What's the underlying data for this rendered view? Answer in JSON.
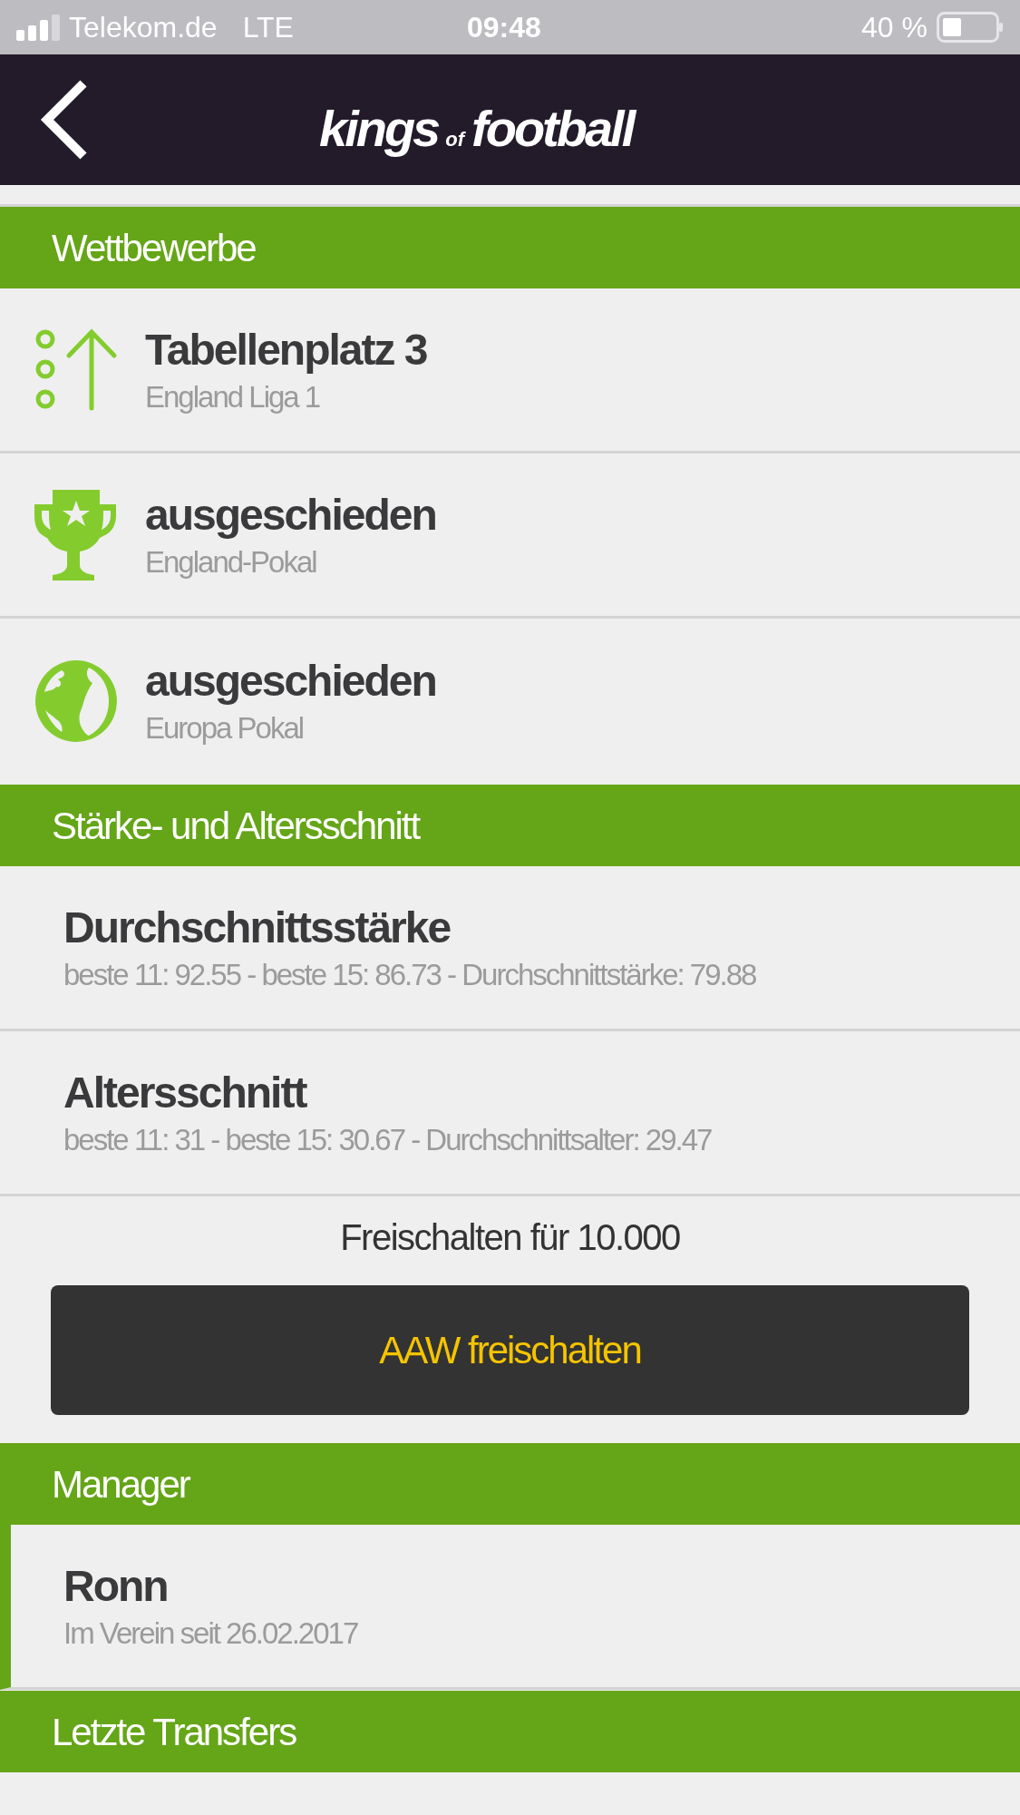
{
  "status_bar": {
    "carrier": "Telekom.de",
    "network": "LTE",
    "time": "09:48",
    "battery": "40 %"
  },
  "header": {
    "logo": [
      "kings",
      "of",
      "football"
    ]
  },
  "sections": [
    {
      "title": "Wettbewerbe",
      "kind": "competitions",
      "items": [
        {
          "kind": "table",
          "title": "Tabellenplatz 3",
          "subtitle": "England Liga 1"
        },
        {
          "kind": "cup",
          "title": "ausgeschieden",
          "subtitle": "England-Pokal"
        },
        {
          "kind": "globe",
          "title": "ausgeschieden",
          "subtitle": "Europa Pokal"
        }
      ]
    },
    {
      "title": "Stärke- und Altersschnitt",
      "kind": "stats",
      "items": [
        {
          "title": "Durchschnittsstärke",
          "subtitle": "beste 11: 92.55 - beste 15: 86.73 - Durchschnittstärke: 79.88"
        },
        {
          "title": "Altersschnitt",
          "subtitle": "beste 11: 31 - beste 15: 30.67 - Durchschnittsalter: 29.47"
        }
      ],
      "unlock_text": "Freischalten für 10.000",
      "unlock_button": "AAW freischalten"
    },
    {
      "title": "Manager",
      "kind": "manager",
      "items": [
        {
          "title": "Ronn",
          "subtitle": "Im Verein seit 26.02.2017"
        }
      ]
    },
    {
      "title": "Letzte Transfers"
    }
  ]
}
